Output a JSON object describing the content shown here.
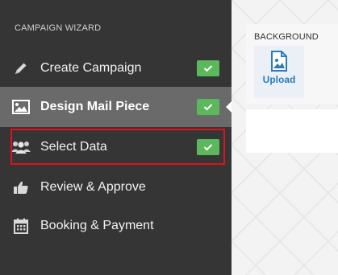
{
  "sidebar": {
    "title": "CAMPAIGN WIZARD",
    "items": [
      {
        "label": "Create Campaign",
        "icon": "pencil-icon",
        "completed": true
      },
      {
        "label": "Design Mail Piece",
        "icon": "image-icon",
        "completed": true,
        "active": true
      },
      {
        "label": "Select Data",
        "icon": "users-icon",
        "completed": true,
        "highlighted": true
      },
      {
        "label": "Review & Approve",
        "icon": "thumbs-up-icon",
        "completed": false
      },
      {
        "label": "Booking & Payment",
        "icon": "calendar-icon",
        "completed": false
      }
    ]
  },
  "toolbar": {
    "section_label": "BACKGROUND",
    "upload_label": "Upload",
    "upload_icon": "image-upload-icon"
  },
  "colors": {
    "sidebar_bg": "#353535",
    "active_item_bg": "#6a6a6a",
    "check_green": "#5cb85c",
    "highlight_red": "#e0121b",
    "upload_blue": "#2a7bbf"
  }
}
